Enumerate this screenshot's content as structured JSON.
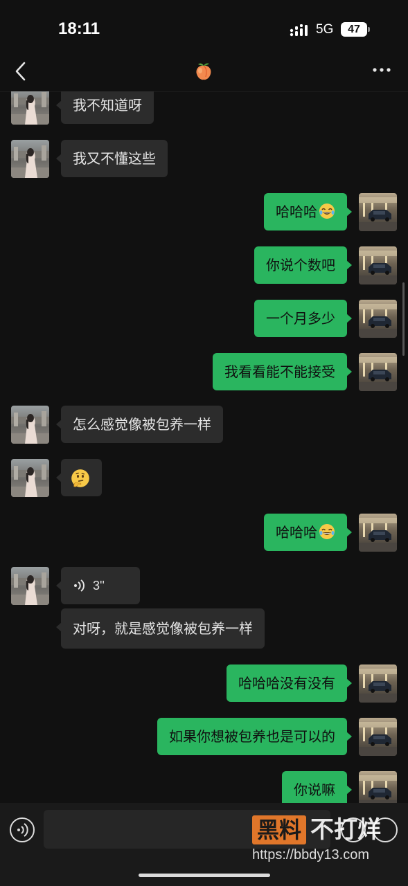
{
  "status_bar": {
    "time": "18:11",
    "network": "5G",
    "battery": "47"
  },
  "header": {
    "contact_icon": "peach-emoji-icon",
    "back_icon": "chevron-left-icon",
    "more_icon": "more-dots-icon"
  },
  "colors": {
    "sent_bubble": "#2ab55f",
    "received_bubble": "#2c2c2c",
    "background": "#111111"
  },
  "messages": [
    {
      "side": "received",
      "text": "我不知道呀"
    },
    {
      "side": "received",
      "text": "我又不懂这些"
    },
    {
      "side": "sent",
      "text": "哈哈哈",
      "emoji": "tears-of-joy-emoji-icon"
    },
    {
      "side": "sent",
      "text": "你说个数吧"
    },
    {
      "side": "sent",
      "text": "一个月多少"
    },
    {
      "side": "sent",
      "text": "我看看能不能接受"
    },
    {
      "side": "received",
      "text": "怎么感觉像被包养一样"
    },
    {
      "side": "received",
      "text": "",
      "emoji": "thinking-face-emoji-icon"
    },
    {
      "side": "sent",
      "text": "哈哈哈",
      "emoji": "tears-of-joy-emoji-icon"
    },
    {
      "side": "received",
      "type": "voice",
      "text": "3''"
    },
    {
      "side": "received",
      "text": "对呀，就是感觉像被包养一样"
    },
    {
      "side": "sent",
      "text": "哈哈哈没有没有"
    },
    {
      "side": "sent",
      "text": "如果你想被包养也是可以的"
    },
    {
      "side": "sent",
      "text": "你说嘛"
    }
  ],
  "input_bar": {
    "placeholder": "",
    "voice_icon": "voice-input-icon",
    "emoji_icon": "emoji-icon",
    "plus_icon": "plus-icon"
  },
  "watermark": {
    "box_text": "黑料",
    "text": "不打烊",
    "url": "https://bbdy13.com"
  }
}
